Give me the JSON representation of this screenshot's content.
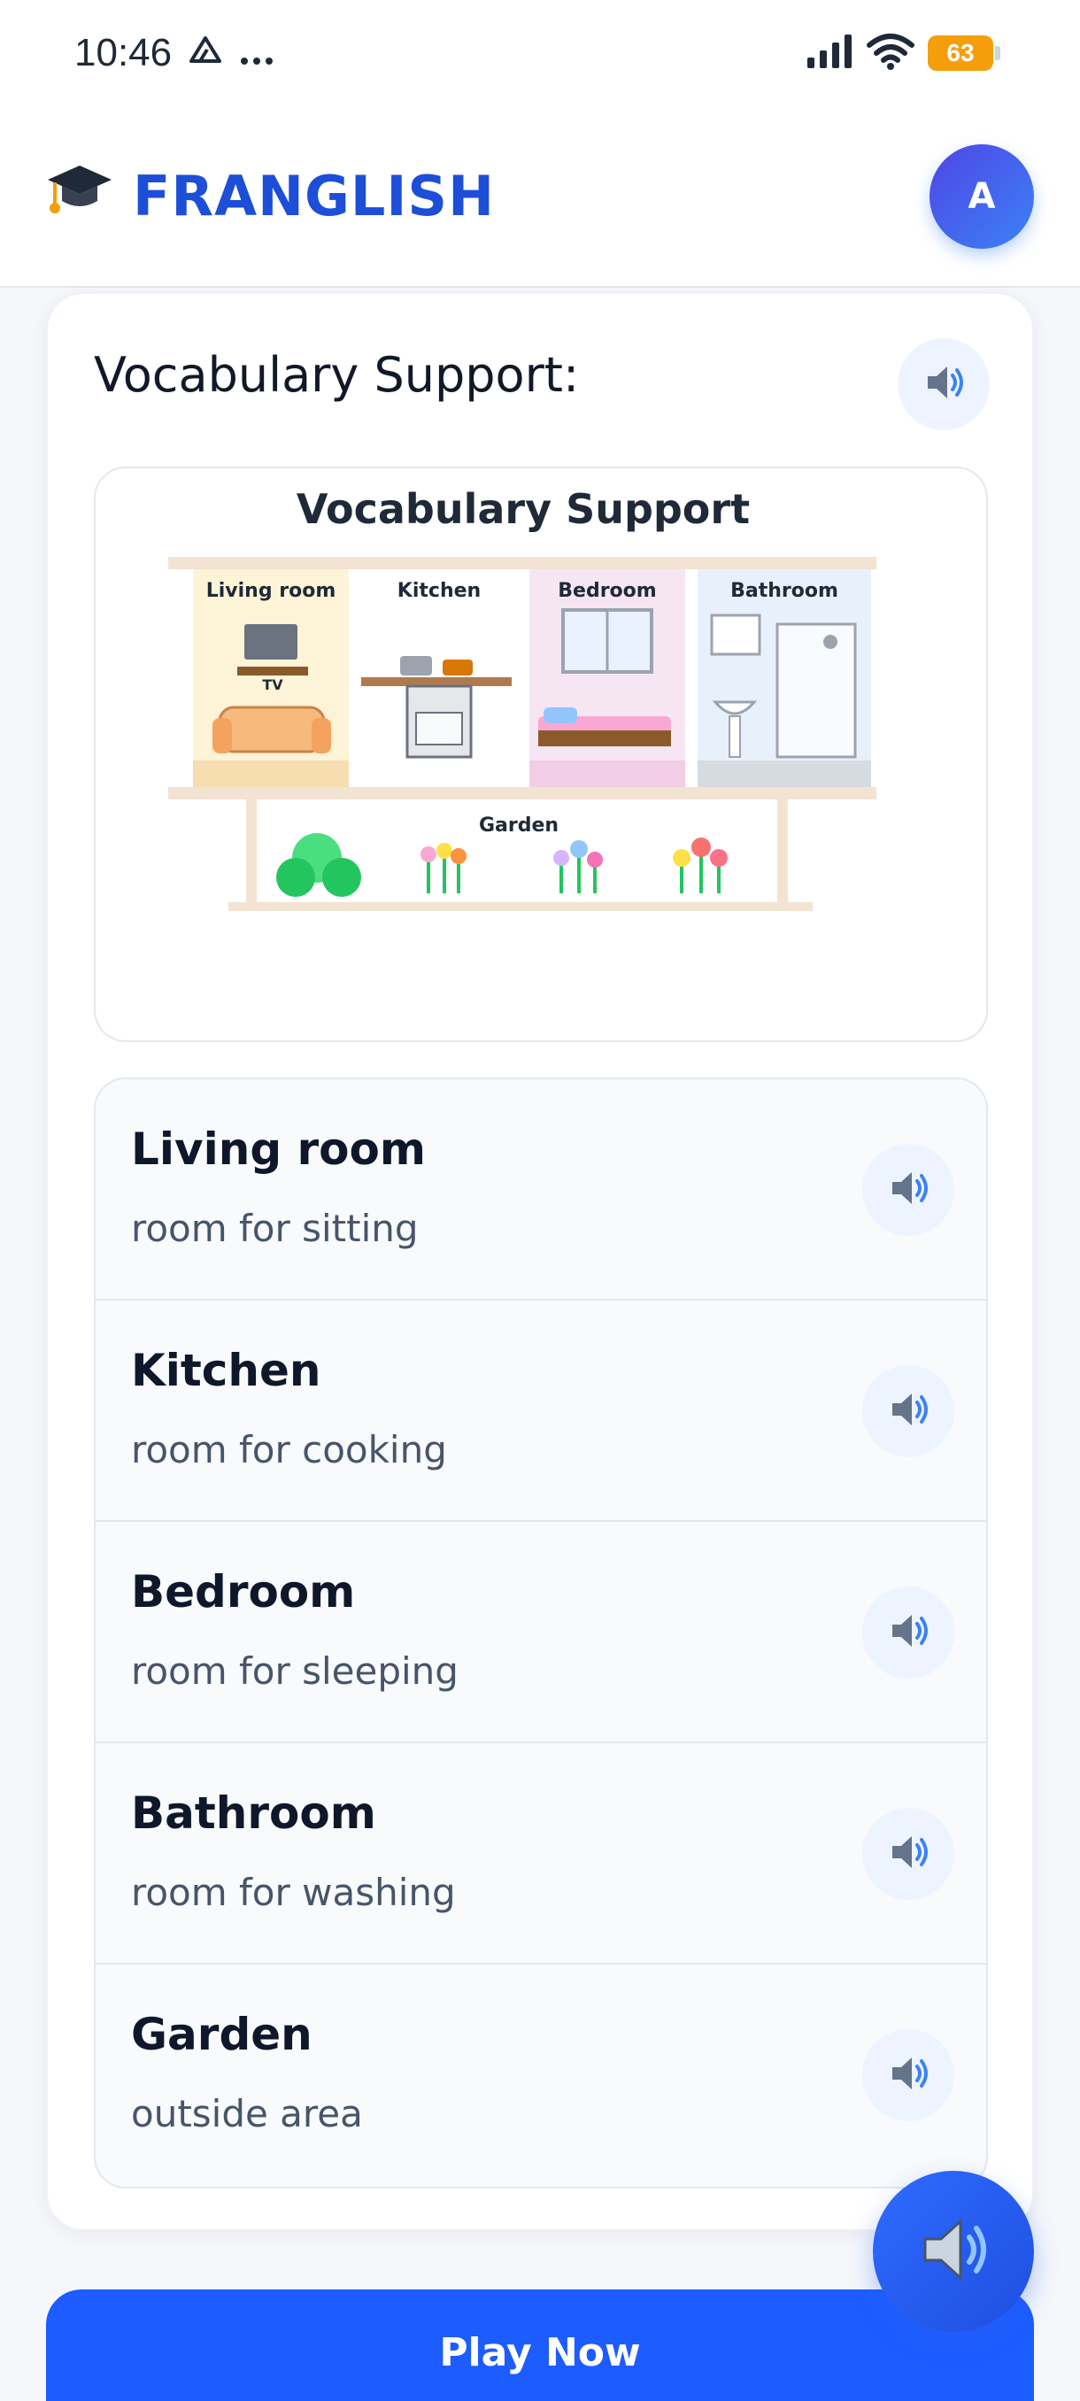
{
  "status_bar": {
    "time": "10:46",
    "battery": "63",
    "icons": [
      "drive-icon",
      "more-dots-icon",
      "signal-icon",
      "wifi-icon",
      "battery-icon"
    ]
  },
  "header": {
    "brand_icon": "graduation-cap-icon",
    "brand_name": "FRANGLISH",
    "avatar_initial": "A"
  },
  "card": {
    "title": "Vocabulary Support:",
    "image": {
      "title": "Vocabulary Support",
      "rooms": [
        "Living room",
        "Kitchen",
        "Bedroom",
        "Bathroom"
      ],
      "tv_label": "TV",
      "garden_label": "Garden"
    },
    "items": [
      {
        "word": "Living room",
        "definition": "room for sitting"
      },
      {
        "word": "Kitchen",
        "definition": "room for cooking"
      },
      {
        "word": "Bedroom",
        "definition": "room for sleeping"
      },
      {
        "word": "Bathroom",
        "definition": "room for washing"
      },
      {
        "word": "Garden",
        "definition": "outside area"
      }
    ]
  },
  "play_button": "Play Now",
  "colors": {
    "brand": "#1d4ed8",
    "primary": "#1d5cff",
    "speaker_bg": "#eef4ff"
  }
}
